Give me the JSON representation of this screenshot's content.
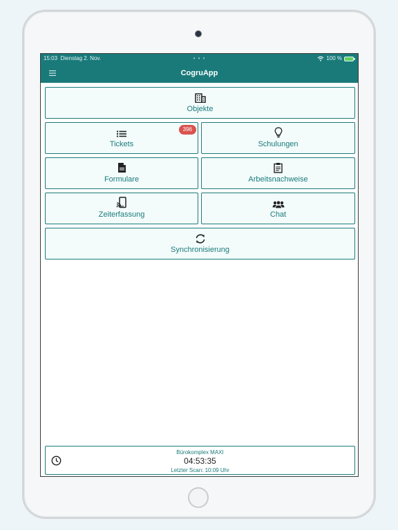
{
  "status": {
    "time": "15:03",
    "date": "Dienstag 2. Nov.",
    "dots": "• • •",
    "battery_text": "100 %"
  },
  "header": {
    "title": "CogruApp"
  },
  "tiles": {
    "objekte": {
      "label": "Objekte",
      "icon": "building-icon"
    },
    "tickets": {
      "label": "Tickets",
      "icon": "list-icon",
      "badge": "396"
    },
    "schulungen": {
      "label": "Schulungen",
      "icon": "lightbulb-icon"
    },
    "formulare": {
      "label": "Formulare",
      "icon": "document-icon"
    },
    "arbeitsnachweise": {
      "label": "Arbeitsnachweise",
      "icon": "clipboard-icon"
    },
    "zeiterfassung": {
      "label": "Zeiterfassung",
      "icon": "nfc-tablet-icon"
    },
    "chat": {
      "label": "Chat",
      "icon": "users-icon"
    },
    "synchronisierung": {
      "label": "Synchronisierung",
      "icon": "sync-icon"
    }
  },
  "footer": {
    "place": "Bürokomplex MAXI",
    "timer": "04:53:35",
    "last_scan": "Letzter Scan: 10:09 Uhr"
  },
  "colors": {
    "primary": "#1a7a7a",
    "tile_bg": "#f3fbfb",
    "badge": "#d9534f"
  }
}
